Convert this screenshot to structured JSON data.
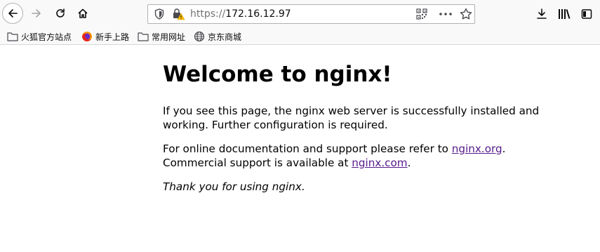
{
  "browser": {
    "url": {
      "protocol": "https://",
      "host": "172.16.12.97"
    },
    "icons": {
      "back": "arrow-left-icon",
      "forward": "arrow-right-icon",
      "reload": "reload-icon",
      "home": "home-icon",
      "tracking": "shield-icon",
      "security": "lock-warning-icon",
      "qr": "qr-code-icon",
      "more": "more-icon",
      "bookmark": "star-icon",
      "downloads": "download-icon",
      "library": "library-icon",
      "sidebar": "sidebar-icon"
    },
    "bookmarks": [
      {
        "label": "火狐官方站点",
        "icon": "folder-icon"
      },
      {
        "label": "新手上路",
        "icon": "firefox-icon"
      },
      {
        "label": "常用网址",
        "icon": "folder-icon"
      },
      {
        "label": "京东商城",
        "icon": "globe-icon"
      }
    ]
  },
  "page": {
    "heading": "Welcome to nginx!",
    "paragraph1": "If you see this page, the nginx web server is successfully installed and working. Further configuration is required.",
    "paragraph2_prefix": "For online documentation and support please refer to ",
    "link1": "nginx.org",
    "paragraph2_mid": ".",
    "paragraph2_line2_prefix": "Commercial support is available at ",
    "link2": "nginx.com",
    "paragraph2_suffix": ".",
    "paragraph3": "Thank you for using nginx.",
    "link_color": "#551a8b"
  }
}
